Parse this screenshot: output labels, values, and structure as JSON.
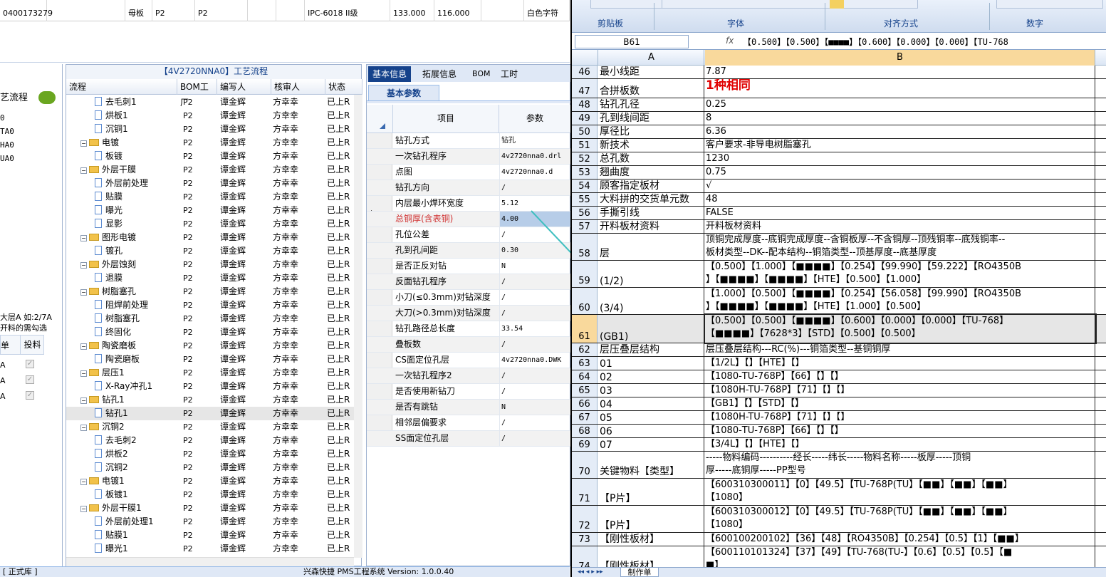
{
  "top_grid": {
    "cells": [
      "0400173279",
      "母板",
      "P2",
      "P2",
      "IPC-6018 II级",
      "133.000",
      "116.000",
      "白色字符"
    ]
  },
  "left_panel": {
    "title": "艺流程",
    "items": [
      "0",
      "TA0",
      "HA0",
      "UA0"
    ],
    "note1": "大层A 如:2/7A",
    "note2": "开料的需勾选",
    "col1": "单",
    "col2": "投料",
    "rows": [
      "A",
      "A",
      "A"
    ]
  },
  "tree": {
    "title": "【4V2720NNA0】工艺流程",
    "headers": [
      "流程",
      "BOM工厂",
      "编写人",
      "核审人",
      "状态"
    ],
    "rows": [
      {
        "name": "去毛刺1",
        "kind": "doc",
        "level": 2,
        "f": "P2",
        "w": "谭金辉",
        "r": "方幸幸",
        "s": "已上R"
      },
      {
        "name": "烘板1",
        "kind": "doc",
        "level": 2,
        "f": "P2",
        "w": "谭金辉",
        "r": "方幸幸",
        "s": "已上R"
      },
      {
        "name": "沉铜1",
        "kind": "doc",
        "level": 2,
        "f": "P2",
        "w": "谭金辉",
        "r": "方幸幸",
        "s": "已上R"
      },
      {
        "name": "电镀",
        "kind": "folder",
        "level": 1,
        "f": "P2",
        "w": "谭金辉",
        "r": "方幸幸",
        "s": "已上R"
      },
      {
        "name": "板镀",
        "kind": "doc",
        "level": 2,
        "f": "P2",
        "w": "谭金辉",
        "r": "方幸幸",
        "s": "已上R"
      },
      {
        "name": "外层干膜",
        "kind": "folder",
        "level": 1,
        "f": "P2",
        "w": "谭金辉",
        "r": "方幸幸",
        "s": "已上R"
      },
      {
        "name": "外层前处理",
        "kind": "doc",
        "level": 2,
        "f": "P2",
        "w": "谭金辉",
        "r": "方幸幸",
        "s": "已上R"
      },
      {
        "name": "贴膜",
        "kind": "doc",
        "level": 2,
        "f": "P2",
        "w": "谭金辉",
        "r": "方幸幸",
        "s": "已上R"
      },
      {
        "name": "曝光",
        "kind": "doc",
        "level": 2,
        "f": "P2",
        "w": "谭金辉",
        "r": "方幸幸",
        "s": "已上R"
      },
      {
        "name": "显影",
        "kind": "doc",
        "level": 2,
        "f": "P2",
        "w": "谭金辉",
        "r": "方幸幸",
        "s": "已上R"
      },
      {
        "name": "图形电镀",
        "kind": "folder",
        "level": 1,
        "f": "P2",
        "w": "谭金辉",
        "r": "方幸幸",
        "s": "已上R"
      },
      {
        "name": "镀孔",
        "kind": "doc",
        "level": 2,
        "f": "P2",
        "w": "谭金辉",
        "r": "方幸幸",
        "s": "已上R"
      },
      {
        "name": "外层蚀刻",
        "kind": "folder",
        "level": 1,
        "f": "P2",
        "w": "谭金辉",
        "r": "方幸幸",
        "s": "已上R"
      },
      {
        "name": "退膜",
        "kind": "doc",
        "level": 2,
        "f": "P2",
        "w": "谭金辉",
        "r": "方幸幸",
        "s": "已上R"
      },
      {
        "name": "树脂塞孔",
        "kind": "folder",
        "level": 1,
        "f": "P2",
        "w": "谭金辉",
        "r": "方幸幸",
        "s": "已上R"
      },
      {
        "name": "阻焊前处理",
        "kind": "doc",
        "level": 2,
        "f": "P2",
        "w": "谭金辉",
        "r": "方幸幸",
        "s": "已上R"
      },
      {
        "name": "树脂塞孔",
        "kind": "doc",
        "level": 2,
        "f": "P2",
        "w": "谭金辉",
        "r": "方幸幸",
        "s": "已上R"
      },
      {
        "name": "终固化",
        "kind": "doc",
        "level": 2,
        "f": "P2",
        "w": "谭金辉",
        "r": "方幸幸",
        "s": "已上R"
      },
      {
        "name": "陶瓷磨板",
        "kind": "folder",
        "level": 1,
        "f": "P2",
        "w": "谭金辉",
        "r": "方幸幸",
        "s": "已上R"
      },
      {
        "name": "陶瓷磨板",
        "kind": "doc",
        "level": 2,
        "f": "P2",
        "w": "谭金辉",
        "r": "方幸幸",
        "s": "已上R"
      },
      {
        "name": "层压1",
        "kind": "folder",
        "level": 1,
        "f": "P2",
        "w": "谭金辉",
        "r": "方幸幸",
        "s": "已上R"
      },
      {
        "name": "X-Ray冲孔1",
        "kind": "doc",
        "level": 2,
        "f": "P2",
        "w": "谭金辉",
        "r": "方幸幸",
        "s": "已上R"
      },
      {
        "name": "钻孔1",
        "kind": "folder",
        "level": 1,
        "f": "P2",
        "w": "谭金辉",
        "r": "方幸幸",
        "s": "已上R"
      },
      {
        "name": "钻孔1",
        "kind": "doc",
        "level": 2,
        "f": "P2",
        "w": "谭金辉",
        "r": "方幸幸",
        "s": "已上R",
        "sel": true
      },
      {
        "name": "沉铜2",
        "kind": "folder",
        "level": 1,
        "f": "P2",
        "w": "谭金辉",
        "r": "方幸幸",
        "s": "已上R"
      },
      {
        "name": "去毛刺2",
        "kind": "doc",
        "level": 2,
        "f": "P2",
        "w": "谭金辉",
        "r": "方幸幸",
        "s": "已上R"
      },
      {
        "name": "烘板2",
        "kind": "doc",
        "level": 2,
        "f": "P2",
        "w": "谭金辉",
        "r": "方幸幸",
        "s": "已上R"
      },
      {
        "name": "沉铜2",
        "kind": "doc",
        "level": 2,
        "f": "P2",
        "w": "谭金辉",
        "r": "方幸幸",
        "s": "已上R"
      },
      {
        "name": "电镀1",
        "kind": "folder",
        "level": 1,
        "f": "P2",
        "w": "谭金辉",
        "r": "方幸幸",
        "s": "已上R"
      },
      {
        "name": "板镀1",
        "kind": "doc",
        "level": 2,
        "f": "P2",
        "w": "谭金辉",
        "r": "方幸幸",
        "s": "已上R"
      },
      {
        "name": "外层干膜1",
        "kind": "folder",
        "level": 1,
        "f": "P2",
        "w": "谭金辉",
        "r": "方幸幸",
        "s": "已上R"
      },
      {
        "name": "外层前处理1",
        "kind": "doc",
        "level": 2,
        "f": "P2",
        "w": "谭金辉",
        "r": "方幸幸",
        "s": "已上R"
      },
      {
        "name": "贴膜1",
        "kind": "doc",
        "level": 2,
        "f": "P2",
        "w": "谭金辉",
        "r": "方幸幸",
        "s": "已上R"
      },
      {
        "name": "曝光1",
        "kind": "doc",
        "level": 2,
        "f": "P2",
        "w": "谭金辉",
        "r": "方幸幸",
        "s": "已上R"
      }
    ]
  },
  "props": {
    "tabs": [
      "基本信息",
      "拓展信息",
      "BOM",
      "工时"
    ],
    "sub_tab": "基本参数",
    "col_item": "项目",
    "col_value": "参数",
    "rows": [
      {
        "k": "钻孔方式",
        "v": "钻孔"
      },
      {
        "k": "一次钻孔程序",
        "v": "4v2720nna0.drl"
      },
      {
        "k": "点图",
        "v": "4v2720nna0.d"
      },
      {
        "k": "钻孔方向",
        "v": "/"
      },
      {
        "k": "内层最小焊环宽度",
        "v": "5.12"
      },
      {
        "k": "总铜厚(含表铜)",
        "v": "4.00",
        "hl": true
      },
      {
        "k": "孔位公差",
        "v": "/"
      },
      {
        "k": "孔到孔间距",
        "v": "0.30"
      },
      {
        "k": "是否正反对钻",
        "v": "N"
      },
      {
        "k": "反面钻孔程序",
        "v": "/"
      },
      {
        "k": "小刀(≤0.3mm)对钻深度",
        "v": "/"
      },
      {
        "k": "大刀(>0.3mm)对钻深度",
        "v": "/"
      },
      {
        "k": "钻孔路径总长度",
        "v": "33.54"
      },
      {
        "k": "叠板数",
        "v": "/"
      },
      {
        "k": "CS面定位孔层",
        "v": "4v2720nna0.DWK"
      },
      {
        "k": "一次钻孔程序2",
        "v": "/"
      },
      {
        "k": "是否使用新钻刀",
        "v": "/"
      },
      {
        "k": "是否有跳钻",
        "v": "N"
      },
      {
        "k": "相邻层偏要求",
        "v": "/"
      },
      {
        "k": "SS面定位孔层",
        "v": "/"
      }
    ]
  },
  "status_bar": {
    "left": "[ 正式库 ]",
    "center": "兴森快捷 PMS工程系统 Version: 1.0.0.40"
  },
  "excel": {
    "ribbon_groups": [
      "剪贴板",
      "字体",
      "对齐方式",
      "数字"
    ],
    "name_box": "B61",
    "formula": "【0.500】【0.500】【■■■■】【0.600】【0.000】【0.000】【TU-768",
    "col_a": "A",
    "col_b": "B",
    "rows": [
      {
        "n": "46",
        "a": "最小线距",
        "b": [
          "7.87"
        ],
        "h": 19
      },
      {
        "n": "47",
        "a": "合拼板数",
        "b": [
          "1种相同"
        ],
        "h": 27,
        "red": true
      },
      {
        "n": "48",
        "a": "钻孔孔径",
        "b": [
          "0.25"
        ],
        "h": 19
      },
      {
        "n": "49",
        "a": "孔到线间距",
        "b": [
          "8"
        ],
        "h": 19
      },
      {
        "n": "50",
        "a": "厚径比",
        "b": [
          "6.36"
        ],
        "h": 19
      },
      {
        "n": "51",
        "a": "新技术",
        "b": [
          "客户要求-非导电树脂塞孔"
        ],
        "h": 19
      },
      {
        "n": "52",
        "a": "总孔数",
        "b": [
          "1230"
        ],
        "h": 19
      },
      {
        "n": "53",
        "a": "翘曲度",
        "b": [
          "0.75"
        ],
        "h": 19
      },
      {
        "n": "54",
        "a": "顾客指定板材",
        "b": [
          "√"
        ],
        "h": 19
      },
      {
        "n": "55",
        "a": "大料拼的交货单元数",
        "b": [
          "48"
        ],
        "h": 19
      },
      {
        "n": "56",
        "a": "手撕引线",
        "b": [
          "FALSE"
        ],
        "h": 19
      },
      {
        "n": "57",
        "a": "开料板材资料",
        "b": [
          "开料板材资料"
        ],
        "h": 19
      },
      {
        "n": "58",
        "a": "层",
        "b": [
          "顶铜完成厚度--底铜完成厚度--含铜板厚--不含铜厚--顶残铜率--底残铜率--",
          "板材类型--DK--配本结构--铜箔类型--顶基厚度--底基厚度"
        ],
        "h": 38
      },
      {
        "n": "59",
        "a": "(1/2)",
        "b": [
          "【0.500】【1.000】【■■■■】【0.254】【99.990】【59.222】【RO4350B",
          "】【■■■■】【■■■■】【HTE】【0.500】【1.000】"
        ],
        "h": 38
      },
      {
        "n": "60",
        "a": "(3/4)",
        "b": [
          "【1.000】【0.500】【■■■■】【0.254】【56.058】【99.990】【RO4350B",
          "】【■■■■】【■■■■】【HTE】【1.000】【0.500】"
        ],
        "h": 38
      },
      {
        "n": "61",
        "a": "(GB1)",
        "b": [
          "【0.500】【0.500】【■■■■】【0.600】【0.000】【0.000】【TU-768】",
          "【■■■■】【7628*3】【STD】【0.500】【0.500】"
        ],
        "h": 40,
        "sel": true
      },
      {
        "n": "62",
        "a": "层压叠层结构",
        "b": [
          "层压叠层结构---RC(%)---铜箔类型--基铜铜厚"
        ],
        "h": 19
      },
      {
        "n": "63",
        "a": "01",
        "b": [
          "【1/2L】【】【HTE】【】"
        ],
        "h": 19
      },
      {
        "n": "64",
        "a": "02",
        "b": [
          "【1080-TU-768P】【66】【】【】"
        ],
        "h": 19
      },
      {
        "n": "65",
        "a": "03",
        "b": [
          "【1080H-TU-768P】【71】【】【】"
        ],
        "h": 19
      },
      {
        "n": "66",
        "a": "04",
        "b": [
          "【GB1】【】【STD】【】"
        ],
        "h": 19
      },
      {
        "n": "67",
        "a": "05",
        "b": [
          "【1080H-TU-768P】【71】【】【】"
        ],
        "h": 19
      },
      {
        "n": "68",
        "a": "06",
        "b": [
          "【1080-TU-768P】【66】【】【】"
        ],
        "h": 19
      },
      {
        "n": "69",
        "a": "07",
        "b": [
          "【3/4L】【】【HTE】【】"
        ],
        "h": 19
      },
      {
        "n": "70",
        "a": "关键物料【类型】",
        "b": [
          "-----物料编码----------经长-----纬长-----物料名称-----板厚-----顶铜",
          "厚-----底铜厚-----PP型号"
        ],
        "h": 38
      },
      {
        "n": "71",
        "a": "【P片】",
        "b": [
          "【600310300011】【0】【49.5】【TU-768P(TU】【■■】【■■】【■■】",
          "【1080】"
        ],
        "h": 38
      },
      {
        "n": "72",
        "a": "【P片】",
        "b": [
          "【600310300012】【0】【49.5】【TU-768P(TU】【■■】【■■】【■■】",
          "【1080】"
        ],
        "h": 38
      },
      {
        "n": "73",
        "a": "【刚性板材】",
        "b": [
          "【600100200102】【36】【48】【RO4350B】【0.254】【0.5】【1】【■■】"
        ],
        "h": 19
      },
      {
        "n": "74",
        "a": "【刚性板材】",
        "b": [
          "【600110101324】【37】【49】【TU-768(TU-】【0.6】【0.5】【0.5】【■",
          "■】"
        ],
        "h": 38
      }
    ],
    "sheet_tab": "制作单"
  }
}
